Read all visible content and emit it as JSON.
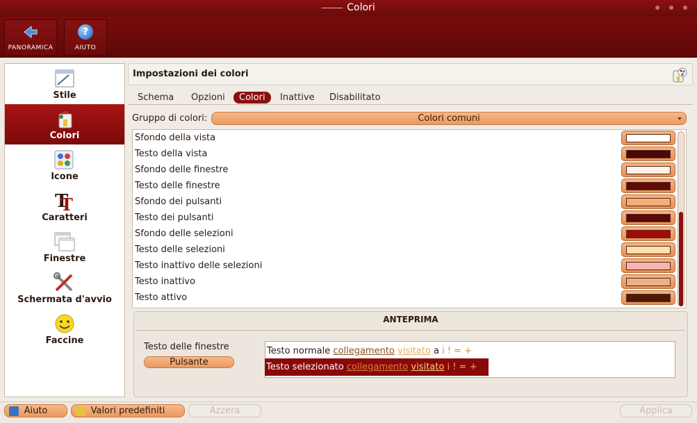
{
  "window": {
    "title": "Colori"
  },
  "toolbar": {
    "items": [
      {
        "label": "PANORAMICA",
        "icon": "back-arrow-icon"
      },
      {
        "label": "AIUTO",
        "icon": "help-icon"
      }
    ]
  },
  "sidebar": {
    "items": [
      {
        "label": "Stile",
        "icon": "style-icon",
        "active": false
      },
      {
        "label": "Colori",
        "icon": "colors-icon",
        "active": true
      },
      {
        "label": "Icone",
        "icon": "icons-icon",
        "active": false
      },
      {
        "label": "Caratteri",
        "icon": "fonts-icon",
        "active": false
      },
      {
        "label": "Finestre",
        "icon": "windows-icon",
        "active": false
      },
      {
        "label": "Schermata d'avvio",
        "icon": "splash-tools-icon",
        "active": false
      },
      {
        "label": "Faccine",
        "icon": "smiley-icon",
        "active": false
      }
    ]
  },
  "header": {
    "title": "Impostazioni dei colori",
    "icon": "color-palette-icon"
  },
  "tabs": [
    {
      "label": "Schema",
      "active": false
    },
    {
      "label": "Opzioni",
      "active": false
    },
    {
      "label": "Colori",
      "active": true
    },
    {
      "label": "Inattive",
      "active": false
    },
    {
      "label": "Disabilitato",
      "active": false
    }
  ],
  "group": {
    "label": "Gruppo di colori:",
    "value": "Colori comuni"
  },
  "colors": [
    {
      "label": "Sfondo della vista",
      "color": "#ffffff"
    },
    {
      "label": "Testo della vista",
      "color": "#4a0808"
    },
    {
      "label": "Sfondo delle finestre",
      "color": "#fdf3ea"
    },
    {
      "label": "Testo delle finestre",
      "color": "#5e0a0a"
    },
    {
      "label": "Sfondo dei pulsanti",
      "color": "#f6ae78"
    },
    {
      "label": "Testo dei pulsanti",
      "color": "#5a0808"
    },
    {
      "label": "Sfondo delle selezioni",
      "color": "#a00c0c"
    },
    {
      "label": "Testo delle selezioni",
      "color": "#ffe2b0"
    },
    {
      "label": "Testo inattivo delle selezioni",
      "color": "#f7b4b0"
    },
    {
      "label": "Testo inattivo",
      "color": "#eab088"
    },
    {
      "label": "Testo attivo",
      "color": "#4a1c06"
    }
  ],
  "preview": {
    "title": "ANTEPRIMA",
    "window_text": "Testo delle finestre",
    "button": "Pulsante",
    "normal": {
      "text": "Testo normale",
      "link": "collegamento",
      "visited": "visitato",
      "a": "a",
      "extra": "i ! = +"
    },
    "selected": {
      "text": "Testo selezionato",
      "link": "collegamento",
      "visited": "visitato",
      "extra": "i ! = +"
    }
  },
  "bottom": {
    "help": "Aiuto",
    "defaults": "Valori predefiniti",
    "reset": "Azzera",
    "apply": "Applica"
  }
}
